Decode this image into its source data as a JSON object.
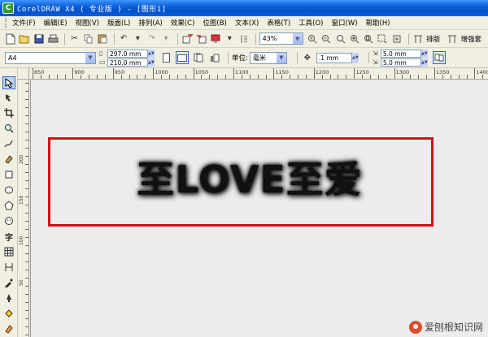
{
  "window": {
    "title": "CorelDRAW X4 ( 专业版 ) - [图形1]",
    "logo_letter": "C"
  },
  "menu": [
    "文件(F)",
    "编辑(E)",
    "视图(V)",
    "版面(L)",
    "排列(A)",
    "效果(C)",
    "位图(B)",
    "文本(X)",
    "表格(T)",
    "工具(O)",
    "窗口(W)",
    "帮助(H)"
  ],
  "toolbar": {
    "zoom": "43%",
    "layout_label": "排版",
    "enhance_label": "增强套"
  },
  "property_bar": {
    "paper_size": "A4",
    "width": "297.0 mm",
    "height": "210.0 mm",
    "units_label": "单位:",
    "units": "毫米",
    "nudge": ".1 mm",
    "dup_x": "5.0 mm",
    "dup_y": "5.0 mm"
  },
  "ruler": {
    "h_labels": [
      "850",
      "900",
      "950",
      "1000",
      "1050",
      "1100",
      "1150",
      "1200",
      "1250",
      "1300",
      "1350",
      "1400"
    ],
    "v_labels": [
      "200",
      "150",
      "100",
      "50"
    ]
  },
  "canvas": {
    "artwork_text": "至LOVE至爱"
  },
  "colors": {
    "frame": "#d40d18",
    "titlebar": "#0a5fd8"
  },
  "watermark": {
    "text": "爱刨根知识网"
  }
}
